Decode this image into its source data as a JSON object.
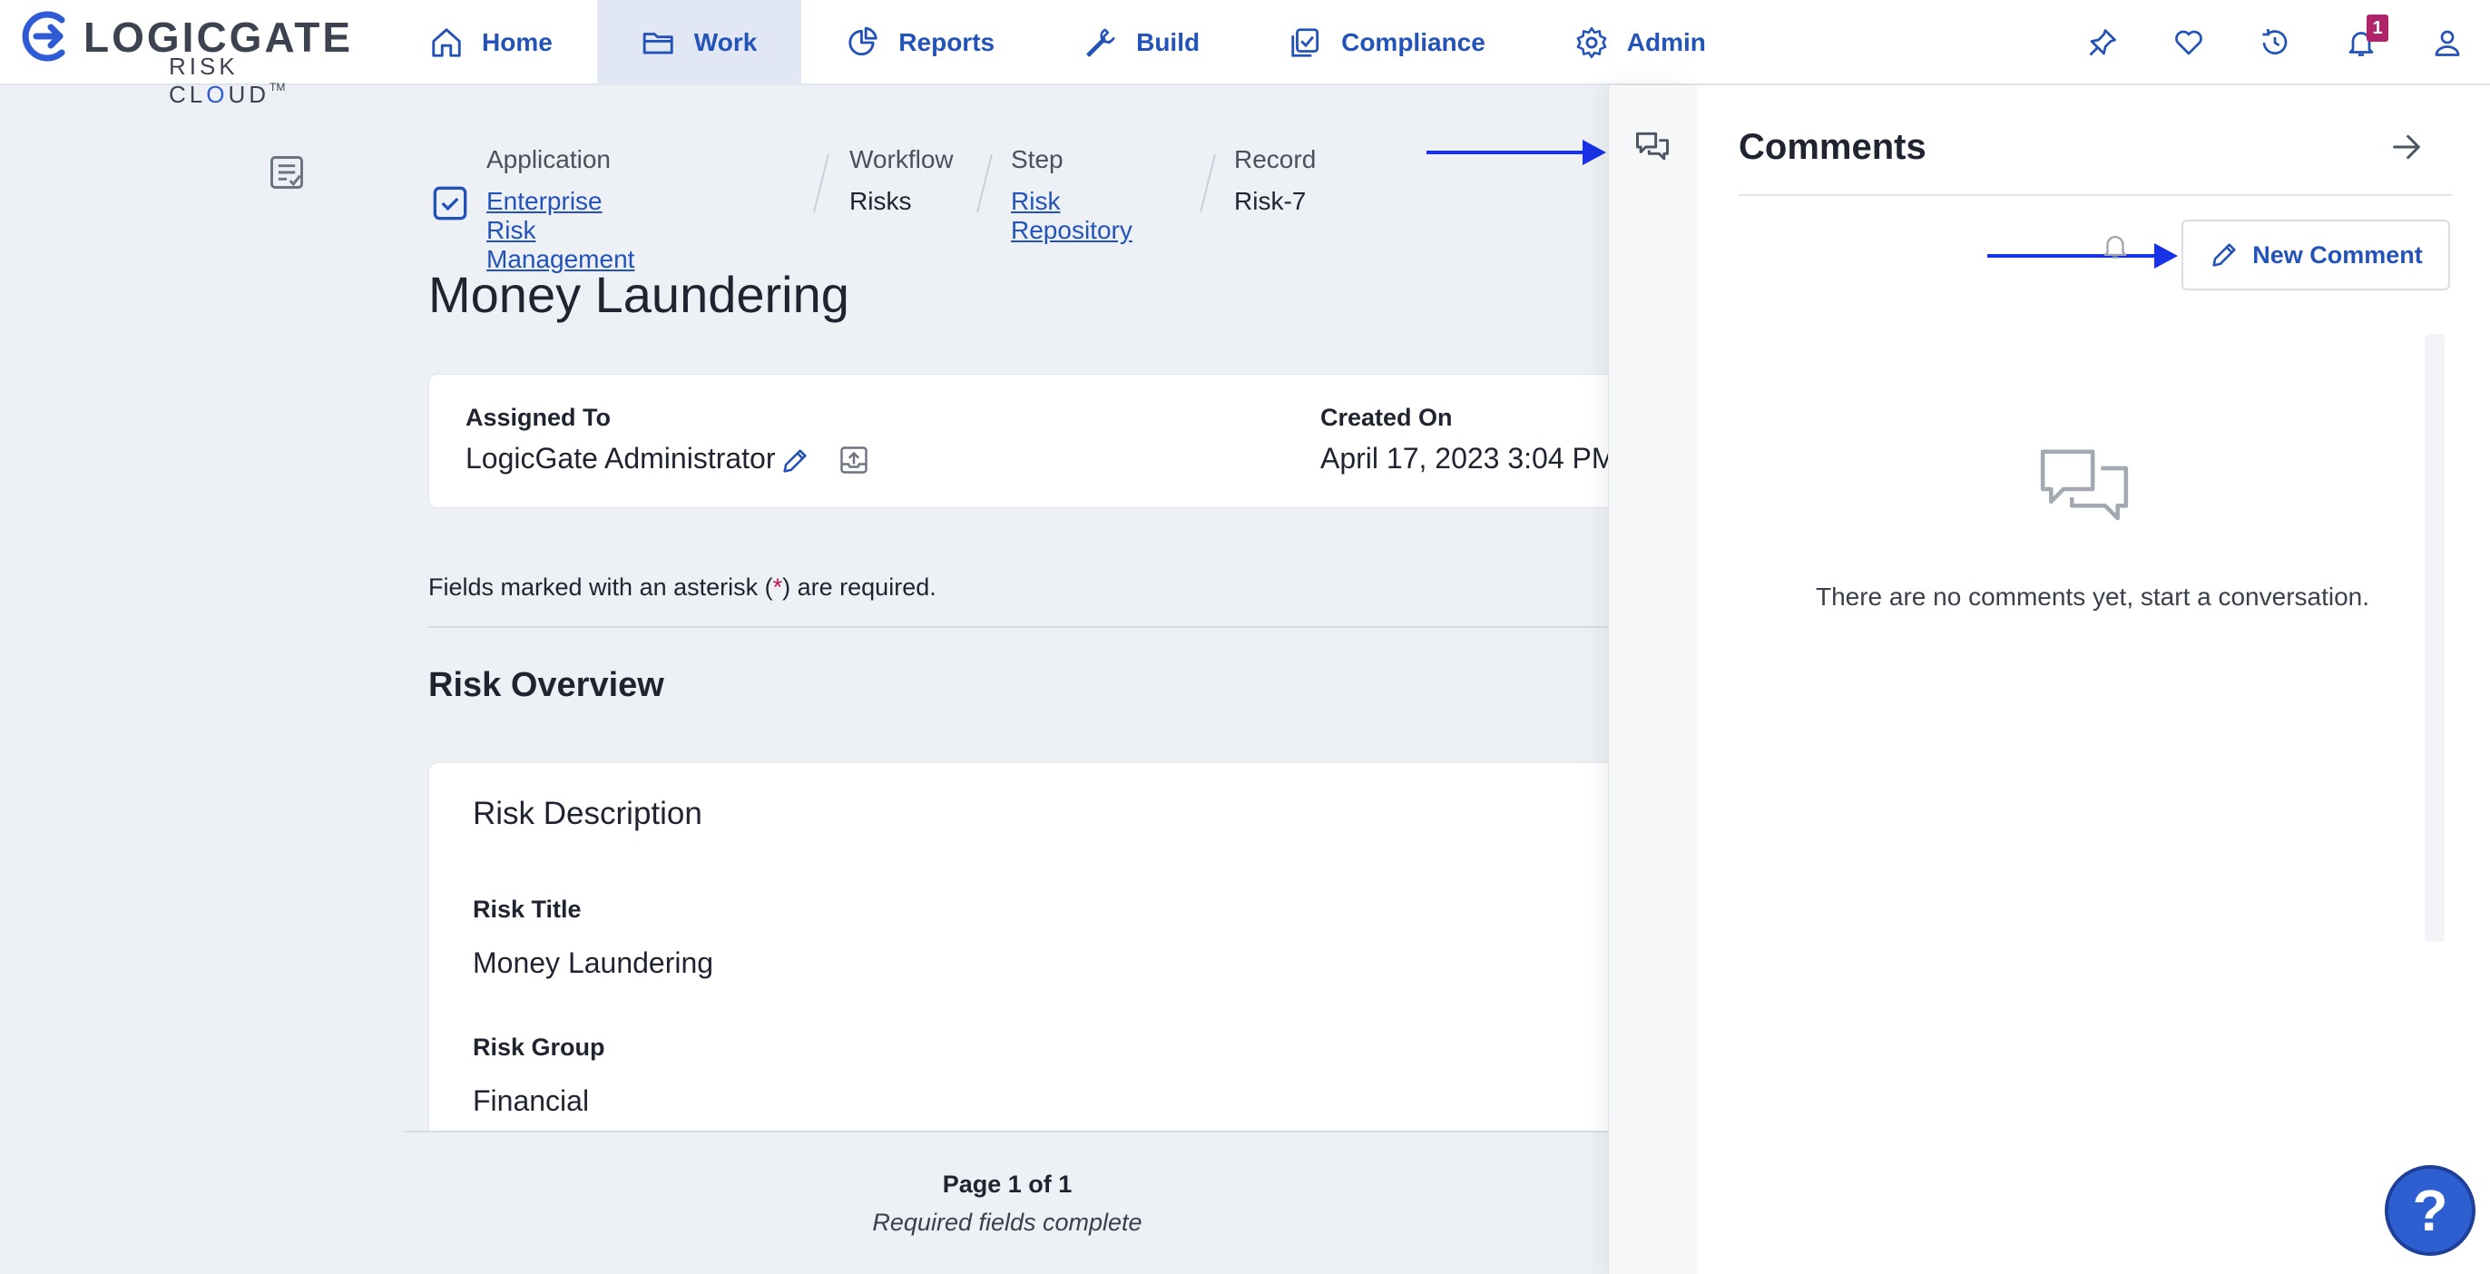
{
  "brand": {
    "name": "LOGICGATE",
    "sub_pre": "RISK CL",
    "sub_dot": "O",
    "sub_post": "UD",
    "tm": "TM"
  },
  "nav": {
    "items": [
      {
        "label": "Home",
        "icon": "home-icon"
      },
      {
        "label": "Work",
        "icon": "folder-icon",
        "active": true
      },
      {
        "label": "Reports",
        "icon": "pie-chart-icon"
      },
      {
        "label": "Build",
        "icon": "wrench-icon"
      },
      {
        "label": "Compliance",
        "icon": "checklist-icon"
      },
      {
        "label": "Admin",
        "icon": "gear-icon"
      }
    ],
    "notification_count": "1"
  },
  "breadcrumb": {
    "application": {
      "label": "Application",
      "value": "Enterprise Risk Management"
    },
    "workflow": {
      "label": "Workflow",
      "value": "Risks"
    },
    "step": {
      "label": "Step",
      "value": "Risk Repository"
    },
    "record": {
      "label": "Record",
      "value": "Risk-7"
    }
  },
  "record": {
    "title": "Money Laundering",
    "assigned_to_label": "Assigned To",
    "assigned_to_value": "LogicGate Administrator",
    "created_on_label": "Created On",
    "created_on_value": "April 17, 2023 3:04 PM"
  },
  "form": {
    "required_note_pre": "Fields marked with an asterisk (",
    "required_note_ast": "*",
    "required_note_post": ") are required.",
    "section_title": "Risk Overview",
    "card_title": "Risk Description",
    "fields": [
      {
        "label": "Risk Title",
        "value": "Money Laundering"
      },
      {
        "label": "Risk Group",
        "value": "Financial"
      }
    ]
  },
  "footer": {
    "page": "Page 1 of 1",
    "status": "Required fields complete"
  },
  "comments": {
    "title": "Comments",
    "new_comment_label": "New Comment",
    "empty_text": "There are no comments yet, start a conversation."
  },
  "colors": {
    "accent": "#2353b8",
    "annotation_arrow": "#1832e6",
    "badge": "#b0246a"
  }
}
